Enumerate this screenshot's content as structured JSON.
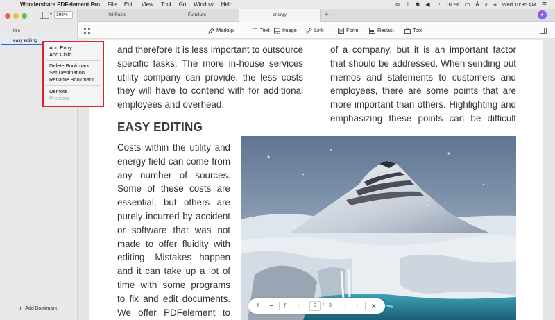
{
  "menubar": {
    "app_name": "Wondershare PDFelement Pro",
    "menus": [
      "File",
      "Edit",
      "View",
      "Tool",
      "Go",
      "Window",
      "Help"
    ],
    "battery": "100%",
    "datetime": "Wed 10:35 AM"
  },
  "sidebar": {
    "zoom": "198%",
    "bookmarks": [
      {
        "label": "title"
      },
      {
        "label": "easy editing"
      }
    ],
    "add_bookmark": "Add Bookmark"
  },
  "context_menu": {
    "groups": [
      [
        {
          "label": "Add Entry",
          "enabled": true
        },
        {
          "label": "Add Child",
          "enabled": true
        }
      ],
      [
        {
          "label": "Delete Bookmark",
          "enabled": true
        },
        {
          "label": "Set Destination",
          "enabled": true
        },
        {
          "label": "Rename Bookmark",
          "enabled": true
        }
      ],
      [
        {
          "label": "Demote",
          "enabled": true
        },
        {
          "label": "Promote",
          "enabled": false
        }
      ]
    ]
  },
  "tabs": [
    {
      "label": "02 Fruits"
    },
    {
      "label": "Furniture"
    },
    {
      "label": "energy",
      "active": true
    }
  ],
  "toolbar": {
    "tools": [
      "Markup",
      "Text",
      "Image",
      "Link",
      "Form",
      "Redact",
      "Tool"
    ]
  },
  "document": {
    "col1_top": [
      "and therefore it is less important to outsource",
      "specific tasks. The more in-house services",
      "utility company can provide, the less costs",
      "they will have to contend with for additional",
      "employees and overhead."
    ],
    "col2_top": [
      "of a company, but it is an important factor",
      "that should be addressed. When sending out",
      "memos and statements to customers and",
      "employees, there are some points that are",
      "more important than others. Highlighting and",
      "emphasizing these points can be difficult"
    ],
    "heading": "EASY EDITING",
    "col1_body": [
      "Costs within the utility and",
      "energy field can come from",
      "any number of sources.",
      "Some of these costs are",
      "essential, but others are",
      "purely incurred by accident",
      "or software that was not",
      "made to offer fluidity with",
      "editing. Mistakes happen",
      "and it can take up a lot of",
      "time with some programs",
      "to fix and edit documents.",
      "We offer PDFelement to"
    ]
  },
  "page_nav": {
    "current_page": "3",
    "separator": "/",
    "total_pages": "3"
  },
  "colors": {
    "highlight_border": "#d8262c",
    "selection_border": "#3b63c4",
    "avatar": "#8a5cf0"
  }
}
